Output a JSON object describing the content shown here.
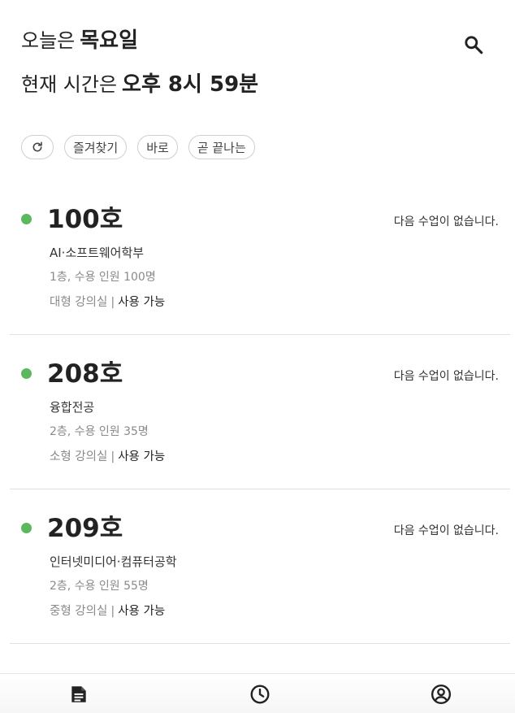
{
  "header": {
    "day_prefix": "오늘은",
    "day_value": "목요일",
    "time_prefix": "현재 시간은",
    "time_value": "오후 8시 59분"
  },
  "search": {
    "icon": "search-icon"
  },
  "filters": {
    "refresh_icon": "refresh-icon",
    "chips": [
      "즐겨찾기",
      "바로",
      "곧 끝나는"
    ]
  },
  "rooms": [
    {
      "number": "100호",
      "next_class": "다음 수업이 없습니다.",
      "department": "AI·소프트웨어학부",
      "capacity": "1층, 수용 인원 100명",
      "type": "대형 강의실",
      "separator": "|",
      "availability": "사용 가능",
      "status_color": "#5cb85c"
    },
    {
      "number": "208호",
      "next_class": "다음 수업이 없습니다.",
      "department": "융합전공",
      "capacity": "2층, 수용 인원 35명",
      "type": "소형 강의실",
      "separator": "|",
      "availability": "사용 가능",
      "status_color": "#5cb85c"
    },
    {
      "number": "209호",
      "next_class": "다음 수업이 없습니다.",
      "department": "인터넷미디어·컴퓨터공학",
      "capacity": "2층, 수용 인원 55명",
      "type": "중형 강의실",
      "separator": "|",
      "availability": "사용 가능",
      "status_color": "#5cb85c"
    }
  ],
  "bottom_nav": {
    "items": [
      "document-icon",
      "clock-icon",
      "account-icon"
    ]
  }
}
